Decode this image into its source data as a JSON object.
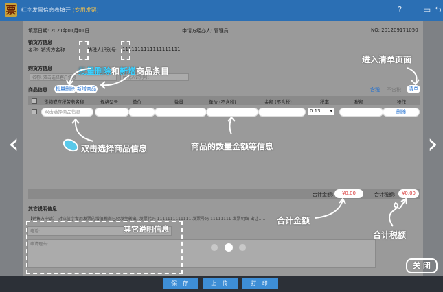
{
  "window": {
    "icon_glyph": "票",
    "title": "红字发票信息表填开",
    "title_sub": "(专用发票)",
    "controls": [
      "?",
      "–",
      "▭",
      "⮌"
    ]
  },
  "header": {
    "date_label": "填票日期: 2021年01月01日",
    "applicant": "申请方经办人: 管理员",
    "no": "NO: 201209171050"
  },
  "seller": {
    "section": "销货方信息",
    "name_label": "名称: 销货方名称",
    "taxid_label": "纳税人识别号:",
    "taxid_value": "1111111111111111111"
  },
  "buyer": {
    "section": "购货方信息",
    "name_placeholder": "名称: 双击选择客户信息",
    "taxid_placeholder": "纳税人识别号:"
  },
  "goods": {
    "section": "商品信息",
    "batch_delete": "批量删除",
    "add_goods": "新增商品",
    "tax_inclusive": "含税",
    "tax_exclusive": "不含税",
    "list": "清单",
    "columns": [
      "货物或应税劳务名称",
      "规格型号",
      "单位",
      "数量",
      "单价 (不含税)",
      "金额 (不含税)",
      "税率",
      "税额",
      "操作"
    ],
    "row": {
      "name_placeholder": "双击选择商品信息",
      "tax_rate": "0.13",
      "action": "删除"
    },
    "total_amount_label": "合计金额:",
    "total_amount": "¥0.00",
    "total_tax_label": "合计税额:",
    "total_tax": "¥0.00"
  },
  "other": {
    "section": "其它说明信息",
    "description": "【销售方申请】 对应蓝字专用发票的增值税尚已经发生转出, 发票代码 1111111111111  发票号码 11111111  发票明细 出让……",
    "phone_label": "电话:",
    "reason_label": "申请理由:"
  },
  "annotations": {
    "batch_text_1": "批量删除",
    "batch_text_2": "和",
    "batch_text_3": "新增",
    "batch_text_4": "商品条目",
    "enter_list": "进入清单页面",
    "double_click": "双击选择商品信息",
    "quantity_info": "商品的数量金额等信息",
    "other_info": "其它说明信息",
    "total_amount": "合计金额",
    "total_tax": "合计税额",
    "close": "关 闭"
  },
  "nav": {
    "prev": "‹",
    "next": "›"
  },
  "pager": {
    "dots": 3,
    "active": 1
  },
  "footer": {
    "save": "保 存",
    "upload": "上 传",
    "print": "打 印"
  }
}
